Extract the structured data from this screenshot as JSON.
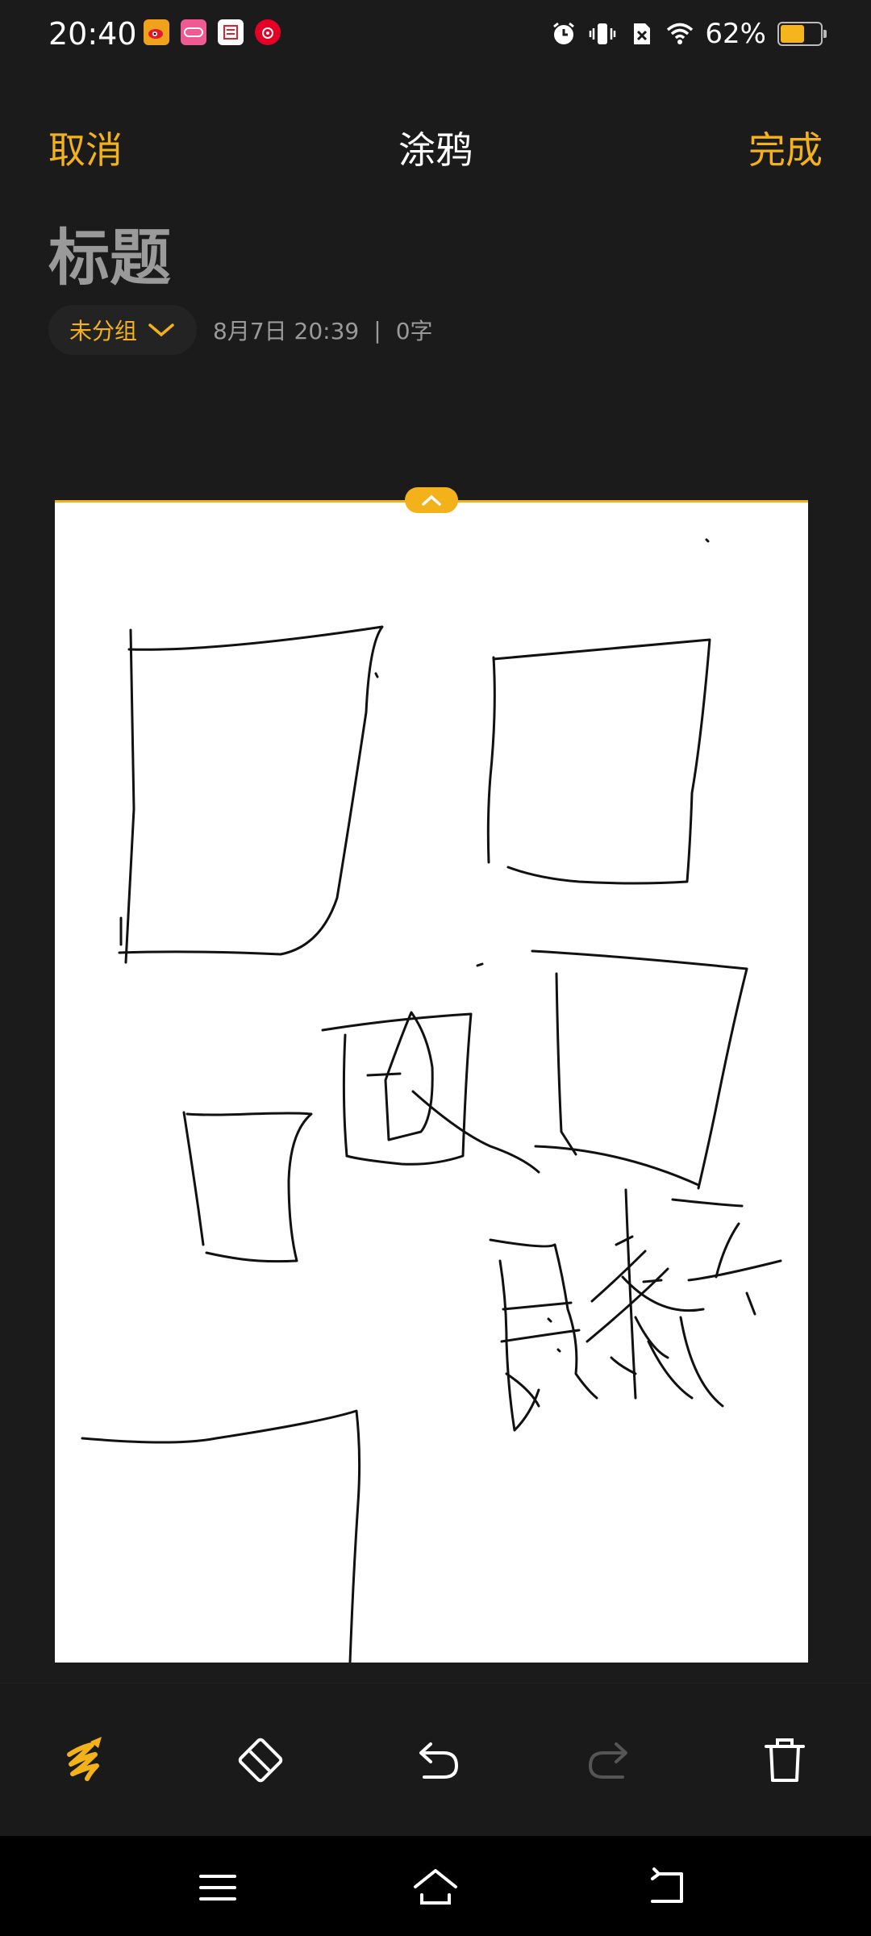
{
  "status_bar": {
    "time": "20:40",
    "app_icons": [
      "weibo-icon",
      "lofter-icon",
      "kitchen-icon",
      "netease-music-icon"
    ],
    "status_icons": [
      "alarm-icon",
      "vibrate-icon",
      "no-sim-icon",
      "wifi-icon"
    ],
    "battery_text": "62%",
    "battery_level": 0.62
  },
  "header": {
    "cancel_label": "取消",
    "title": "涂鸦",
    "done_label": "完成"
  },
  "note": {
    "title": "标题",
    "group_label": "未分组",
    "date": "8月7日 20:39",
    "separator": "|",
    "word_count": "0字"
  },
  "toolbar": {
    "tools": [
      "pen-icon",
      "eraser-icon",
      "undo-icon",
      "redo-icon",
      "trash-icon"
    ],
    "redo_enabled": false
  },
  "navbar": {
    "buttons": [
      "menu-icon",
      "home-icon",
      "back-icon"
    ]
  },
  "colors": {
    "accent": "#f3b21a",
    "background": "#1b1b1b",
    "muted_text": "#9a9a9a"
  }
}
